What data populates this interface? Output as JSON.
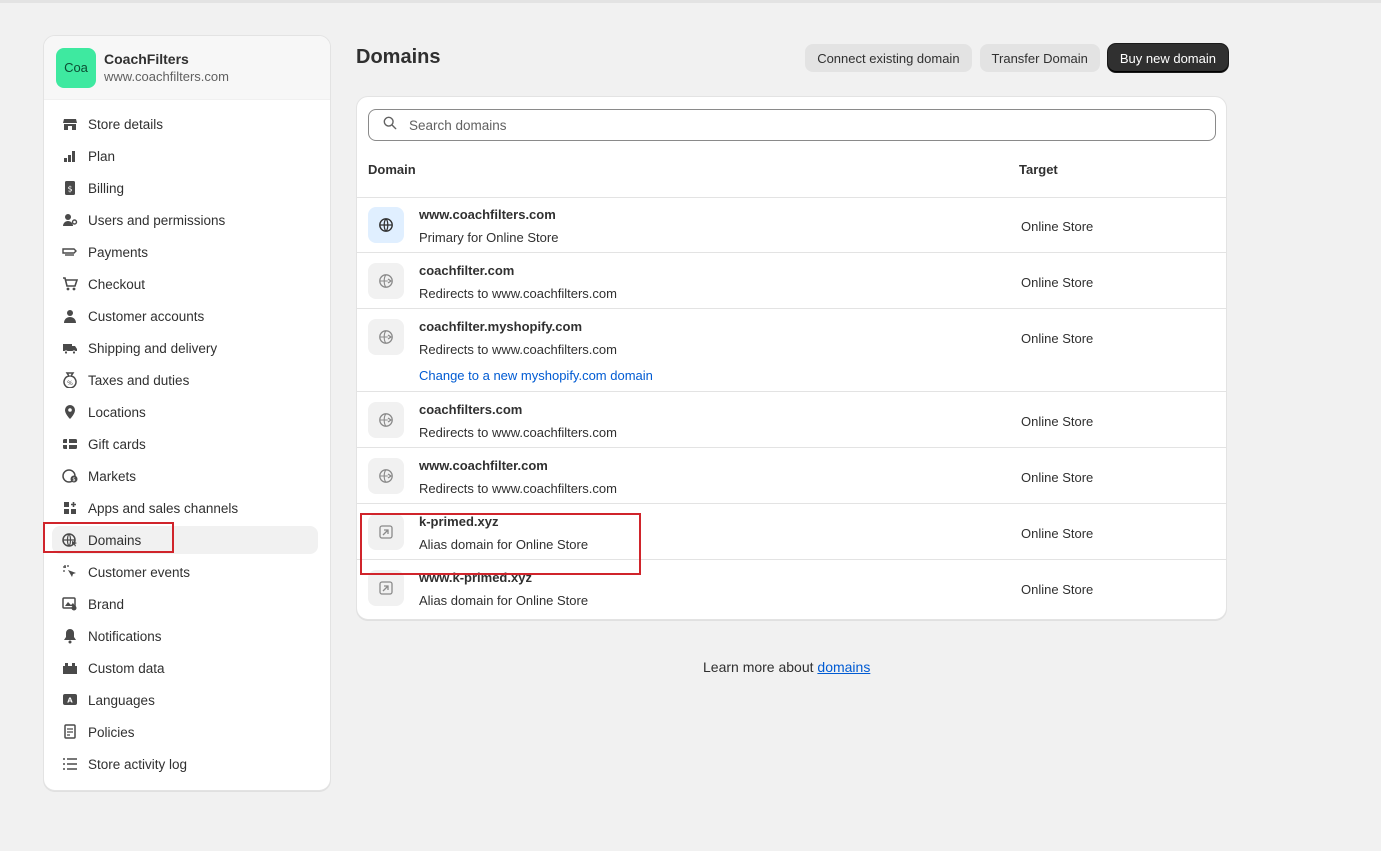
{
  "store": {
    "avatar_text": "Coa",
    "name": "CoachFilters",
    "url": "www.coachfilters.com"
  },
  "nav": [
    {
      "label": "Store details",
      "icon": "store-icon"
    },
    {
      "label": "Plan",
      "icon": "plan-icon"
    },
    {
      "label": "Billing",
      "icon": "billing-icon"
    },
    {
      "label": "Users and permissions",
      "icon": "users-icon"
    },
    {
      "label": "Payments",
      "icon": "payments-icon"
    },
    {
      "label": "Checkout",
      "icon": "cart-icon"
    },
    {
      "label": "Customer accounts",
      "icon": "person-icon"
    },
    {
      "label": "Shipping and delivery",
      "icon": "truck-icon"
    },
    {
      "label": "Taxes and duties",
      "icon": "tax-icon"
    },
    {
      "label": "Locations",
      "icon": "location-icon"
    },
    {
      "label": "Gift cards",
      "icon": "gift-card-icon"
    },
    {
      "label": "Markets",
      "icon": "globe-currency-icon"
    },
    {
      "label": "Apps and sales channels",
      "icon": "apps-icon"
    },
    {
      "label": "Domains",
      "icon": "domain-globe-icon",
      "active": true
    },
    {
      "label": "Customer events",
      "icon": "cursor-icon"
    },
    {
      "label": "Brand",
      "icon": "brand-icon"
    },
    {
      "label": "Notifications",
      "icon": "bell-icon"
    },
    {
      "label": "Custom data",
      "icon": "custom-data-icon"
    },
    {
      "label": "Languages",
      "icon": "language-icon"
    },
    {
      "label": "Policies",
      "icon": "policy-icon"
    },
    {
      "label": "Store activity log",
      "icon": "list-icon"
    }
  ],
  "page": {
    "title": "Domains",
    "buttons": {
      "connect": "Connect existing domain",
      "transfer": "Transfer Domain",
      "buy": "Buy new domain"
    }
  },
  "search": {
    "placeholder": "Search domains"
  },
  "table": {
    "columns": {
      "domain": "Domain",
      "target": "Target"
    },
    "rows": [
      {
        "name": "www.coachfilters.com",
        "sub": "Primary for Online Store",
        "target": "Online Store",
        "icon": "globe-icon"
      },
      {
        "name": "coachfilter.com",
        "sub": "Redirects to www.coachfilters.com",
        "target": "Online Store",
        "icon": "redirect-globe-icon"
      },
      {
        "name": "coachfilter.myshopify.com",
        "sub": "Redirects to www.coachfilters.com",
        "target": "Online Store",
        "icon": "redirect-globe-icon",
        "link": "Change to a new myshopify.com domain"
      },
      {
        "name": "coachfilters.com",
        "sub": "Redirects to www.coachfilters.com",
        "target": "Online Store",
        "icon": "redirect-globe-icon"
      },
      {
        "name": "www.coachfilter.com",
        "sub": "Redirects to www.coachfilters.com",
        "target": "Online Store",
        "icon": "redirect-globe-icon"
      },
      {
        "name": "k-primed.xyz",
        "sub": "Alias domain for Online Store",
        "target": "Online Store",
        "icon": "alias-icon"
      },
      {
        "name": "www.k-primed.xyz",
        "sub": "Alias domain for Online Store",
        "target": "Online Store",
        "icon": "alias-icon"
      }
    ]
  },
  "footer": {
    "text": "Learn more about ",
    "link": "domains"
  }
}
